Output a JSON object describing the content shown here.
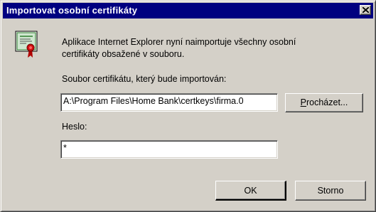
{
  "window": {
    "title": "Importovat osobní certifikáty"
  },
  "content": {
    "info_line1": "Aplikace Internet Explorer nyní naimportuje všechny osobní",
    "info_line2": "certifikáty obsažené v souboru.",
    "file_label": "Soubor certifikátu, který bude importován:",
    "file_value": "A:\\Program Files\\Home Bank\\certkeys\\firma.0",
    "password_label": "Heslo:",
    "password_value": "*"
  },
  "buttons": {
    "browse_accel": "P",
    "browse_rest": "rocházet...",
    "ok": "OK",
    "cancel": "Storno"
  },
  "icons": {
    "certificate": "certificate-icon",
    "close": "close-icon"
  },
  "colors": {
    "titlebar": "#000080",
    "face": "#d4d0c8"
  }
}
